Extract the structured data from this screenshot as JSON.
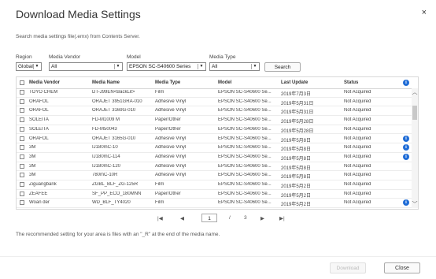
{
  "dialog": {
    "title": "Download Media Settings",
    "close_glyph": "×"
  },
  "description": "Search media settings file(.emx) from Contents Server.",
  "filters": {
    "region": {
      "label": "Region",
      "value": "Global"
    },
    "media_vendor": {
      "label": "Media Vendor",
      "value": "All"
    },
    "model": {
      "label": "Model",
      "value": "EPSON SC-S40600 Series"
    },
    "media_type": {
      "label": "Media Type",
      "value": "All"
    },
    "search_label": "Search"
  },
  "table": {
    "headers": [
      "Media Vendor",
      "Media Name",
      "Media Type",
      "Model",
      "Last Update",
      "Status"
    ],
    "rows": [
      {
        "vendor": "TOYO CHEM",
        "name": "DT-J99EN<BackLit>",
        "type": "Film",
        "model": "EPSON SC-S40600 Se...",
        "update": "2019年7月3日",
        "status": "Not Acquired",
        "info": false
      },
      {
        "vendor": "ORAFOL",
        "name": "ORAJET 3951GRA-010",
        "type": "Adhesive Vinyl",
        "model": "EPSON SC-S40600 Se...",
        "update": "2019年5月31日",
        "status": "Not Acquired",
        "info": false
      },
      {
        "vendor": "ORAFOL",
        "name": "ORAJET 3169G-010",
        "type": "Adhesive Vinyl",
        "model": "EPSON SC-S40600 Se...",
        "update": "2019年5月31日",
        "status": "Not Acquired",
        "info": false
      },
      {
        "vendor": "SOLEITA",
        "name": "FD-M1009 M",
        "type": "Paper/Other",
        "model": "EPSON SC-S40600 Se...",
        "update": "2019年5月28日",
        "status": "Not Acquired",
        "info": false
      },
      {
        "vendor": "SOLEITA",
        "name": "FD-M50043",
        "type": "Paper/Other",
        "model": "EPSON SC-S40600 Se...",
        "update": "2019年5月28日",
        "status": "Not Acquired",
        "info": false
      },
      {
        "vendor": "ORAFOL",
        "name": "ORAJET 3165G-010",
        "type": "Adhesive Vinyl",
        "model": "EPSON SC-S40600 Se...",
        "update": "2019年5月8日",
        "status": "Not Acquired",
        "info": true
      },
      {
        "vendor": "3M",
        "name": "IJ180mC-10",
        "type": "Adhesive Vinyl",
        "model": "EPSON SC-S40600 Se...",
        "update": "2019年5月8日",
        "status": "Not Acquired",
        "info": true
      },
      {
        "vendor": "3M",
        "name": "IJ180mC-114",
        "type": "Adhesive Vinyl",
        "model": "EPSON SC-S40600 Se...",
        "update": "2019年5月8日",
        "status": "Not Acquired",
        "info": true
      },
      {
        "vendor": "3M",
        "name": "IJ180mC-120",
        "type": "Adhesive Vinyl",
        "model": "EPSON SC-S40600 Se...",
        "update": "2019年5月8日",
        "status": "Not Acquired",
        "info": false
      },
      {
        "vendor": "3M",
        "name": "780mC-10R",
        "type": "Adhesive Vinyl",
        "model": "EPSON SC-S40600 Se...",
        "update": "2019年5月8日",
        "status": "Not Acquired",
        "info": false
      },
      {
        "vendor": "Ziguangbank",
        "name": "ZGBL_BLF_ZG-125R",
        "type": "Film",
        "model": "EPSON SC-S40600 Se...",
        "update": "2019年5月2日",
        "status": "Not Acquired",
        "info": false
      },
      {
        "vendor": "ZEAFEE",
        "name": "SF_PP_ECO_180MNN",
        "type": "Paper/Other",
        "model": "EPSON SC-S40600 Se...",
        "update": "2019年5月2日",
        "status": "Not Acquired",
        "info": false
      },
      {
        "vendor": "Woan der",
        "name": "WD_BLF_TY4020",
        "type": "Film",
        "model": "EPSON SC-S40600 Se...",
        "update": "2019年5月2日",
        "status": "Not Acquired",
        "info": true
      }
    ]
  },
  "pagination": {
    "first": "|◀",
    "prev": "◀",
    "current": "1",
    "separator": "/",
    "total": "3",
    "next": "▶",
    "last": "▶|"
  },
  "note": "The recommended setting for your area is files with an \"_R\" at the end of the media name.",
  "footer": {
    "download_label": "Download",
    "close_label": "Close"
  },
  "colors": {
    "info": "#1f6cd6"
  }
}
